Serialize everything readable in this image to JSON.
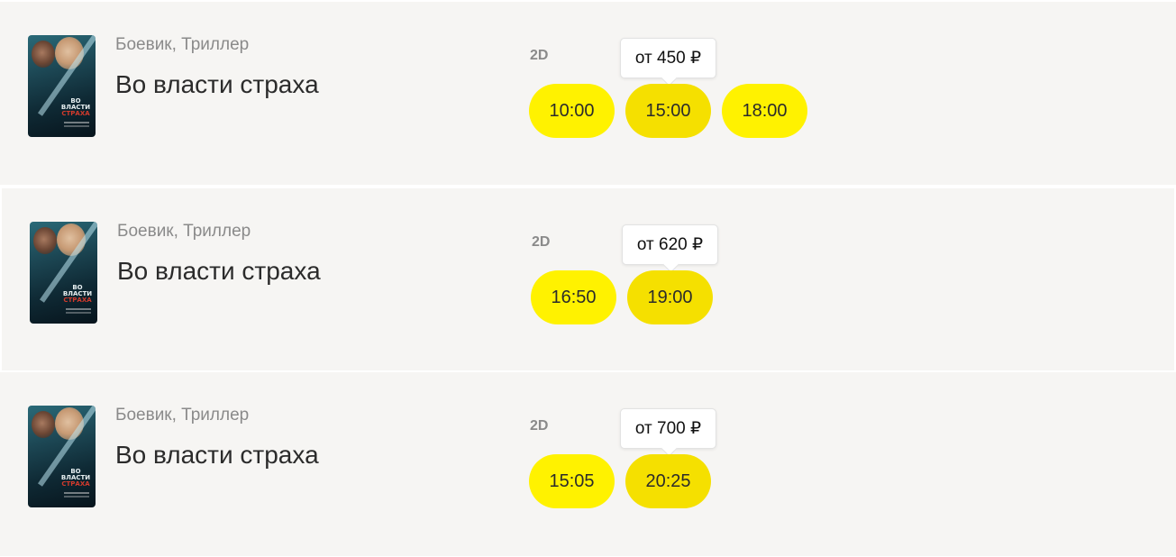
{
  "rows": [
    {
      "genre": "Боевик, Триллер",
      "title": "Во власти страха",
      "format": "2D",
      "price_tooltip": "от 450 ₽",
      "sessions": [
        "10:00",
        "15:00",
        "18:00"
      ]
    },
    {
      "genre": "Боевик, Триллер",
      "title": "Во власти страха",
      "format": "2D",
      "price_tooltip": "от 620 ₽",
      "sessions": [
        "16:50",
        "19:00"
      ]
    },
    {
      "genre": "Боевик, Триллер",
      "title": "Во власти страха",
      "format": "2D",
      "price_tooltip": "от 700 ₽",
      "sessions": [
        "15:05",
        "20:25"
      ]
    }
  ],
  "poster_text": {
    "line1": "ВО ВЛАСТИ",
    "line2": "СТРАХА"
  },
  "colors": {
    "session_button": "#fff200",
    "card_background": "#f6f5f3"
  }
}
